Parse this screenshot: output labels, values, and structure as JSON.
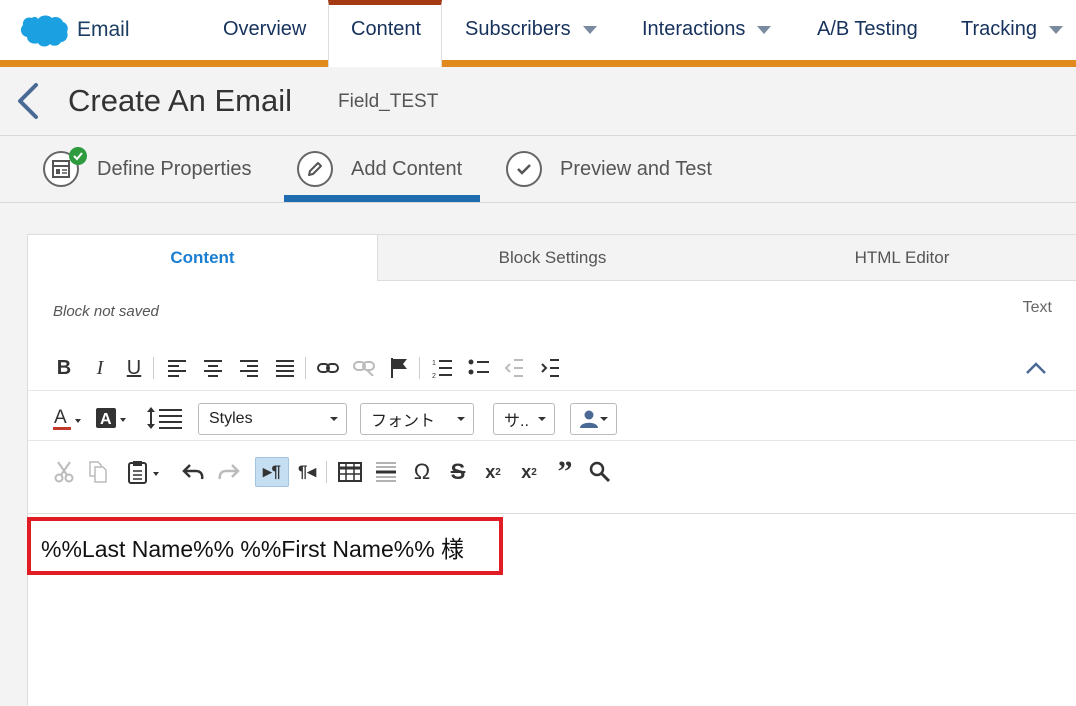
{
  "nav": {
    "app_name": "Email",
    "tabs": [
      {
        "label": "Overview"
      },
      {
        "label": "Content"
      },
      {
        "label": "Subscribers"
      },
      {
        "label": "Interactions"
      },
      {
        "label": "A/B Testing"
      },
      {
        "label": "Tracking"
      }
    ],
    "active_tab": "Content",
    "brand_color": "#e08a1e",
    "logo_color": "#1ba1e2"
  },
  "header": {
    "title": "Create An Email",
    "subtitle": "Field_TEST"
  },
  "steps": [
    {
      "label": "Define Properties",
      "icon": "layout-icon",
      "completed": true
    },
    {
      "label": "Add Content",
      "icon": "pencil-icon",
      "active": true
    },
    {
      "label": "Preview and Test",
      "icon": "check-icon"
    }
  ],
  "editor": {
    "tabs": [
      {
        "label": "Content"
      },
      {
        "label": "Block Settings"
      },
      {
        "label": "HTML Editor"
      }
    ],
    "active_tab": "Content",
    "block_status": "Block not saved",
    "block_type": "Text",
    "styles_dropdown": "Styles",
    "font_dropdown": "フォント",
    "size_dropdown": "サ..",
    "content_text": "%%Last Name%% %%First Name%% 様",
    "highlight_color": "#e01d25"
  }
}
